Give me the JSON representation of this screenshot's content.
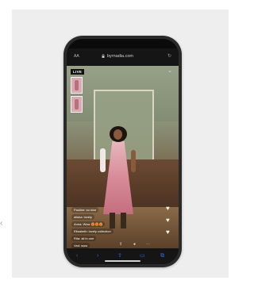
{
  "statusbar": {
    "time": "",
    "sys": ""
  },
  "browser": {
    "text_size_label": "AA",
    "url": "byrnadia.com"
  },
  "stream": {
    "live_label": "LIVE"
  },
  "comments": [
    "Pauline: so nice",
    "alisha: lovely",
    "Anna: Wow 😍😍😍",
    "Elisabeth: lovely collection",
    "Rita: all in one",
    "Ved: wow"
  ],
  "icons": {
    "close": "chevron-down-icon",
    "reload": "reload-icon",
    "lock": "lock-icon",
    "heart": "heart-icon",
    "back": "back-icon",
    "forward": "forward-icon",
    "share": "share-icon",
    "bookmarks": "bookmarks-icon",
    "tabs": "tabs-icon"
  }
}
